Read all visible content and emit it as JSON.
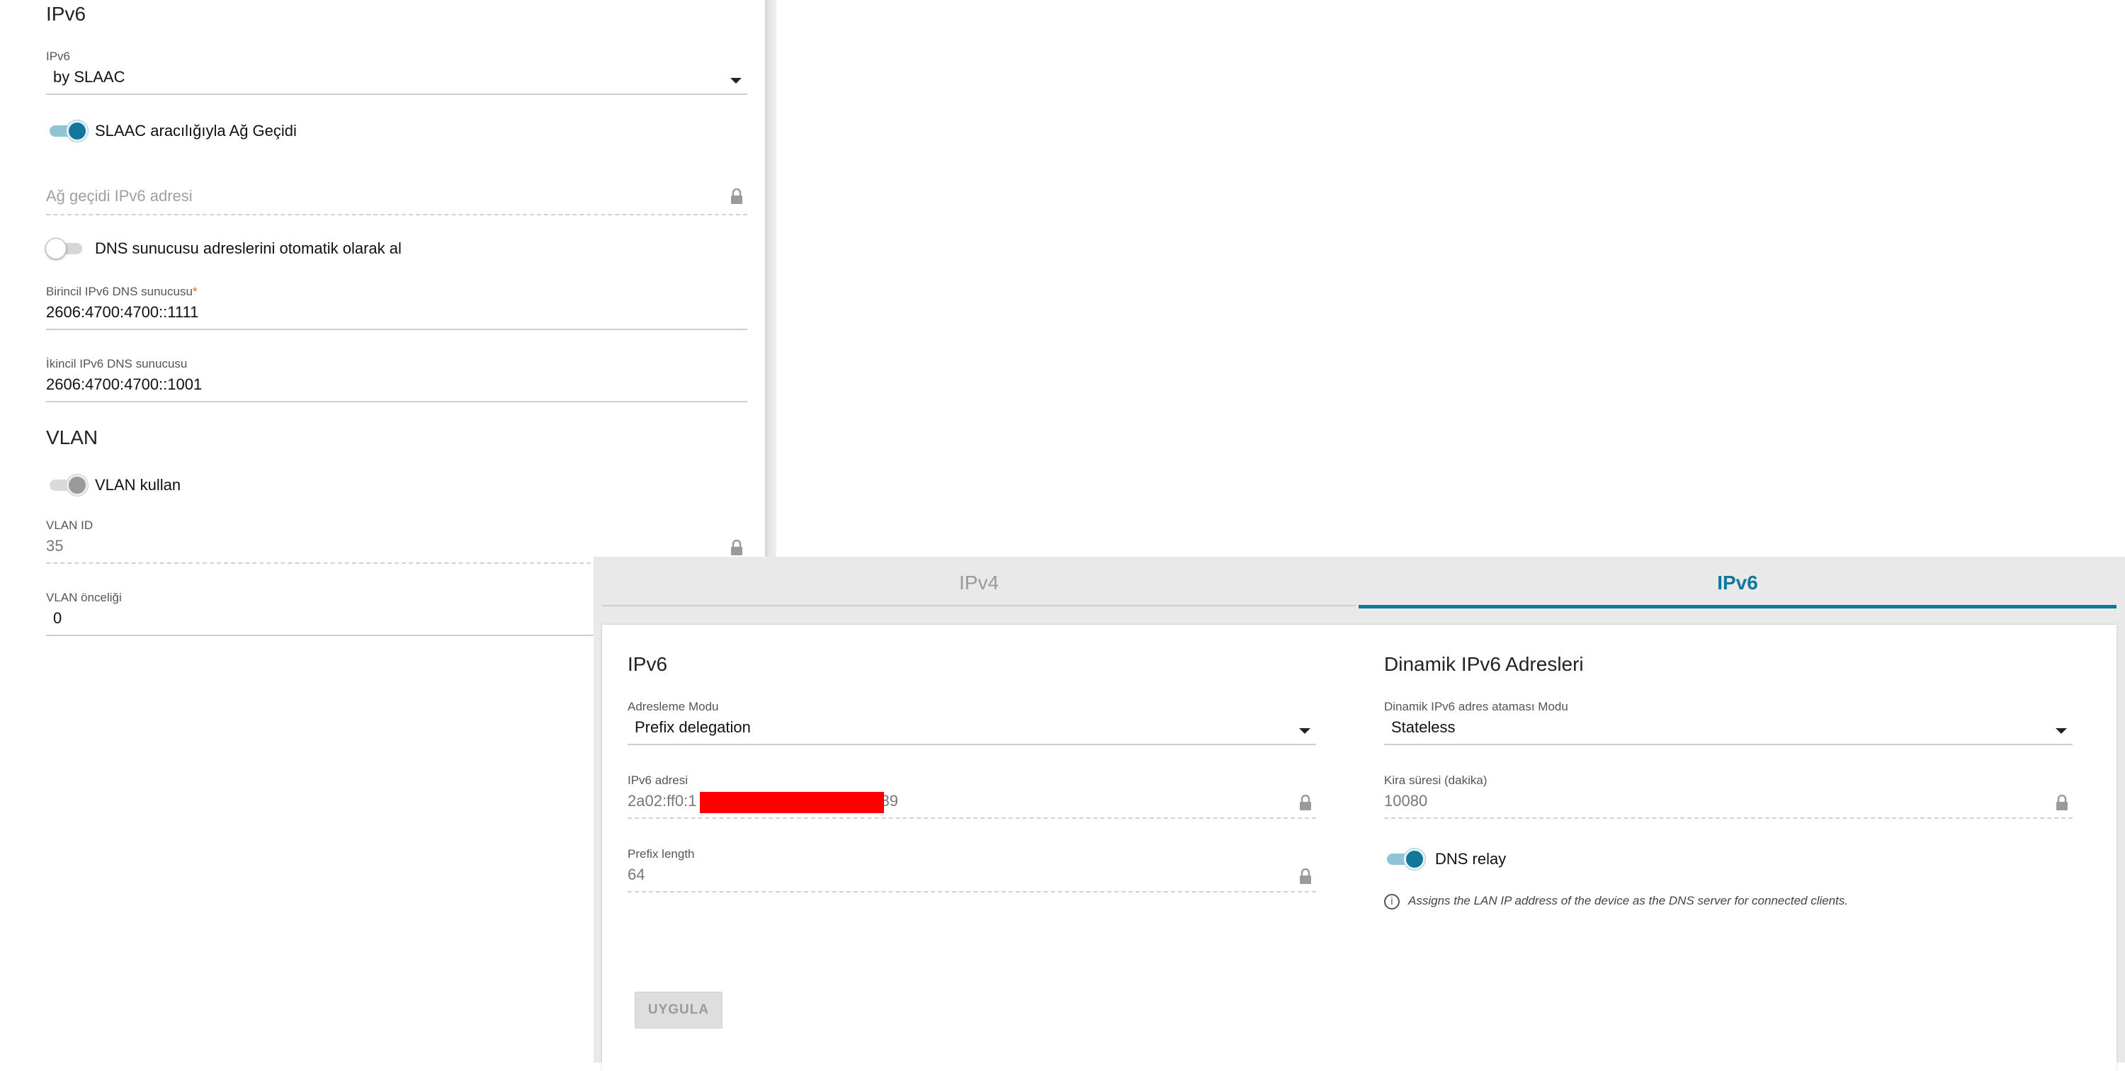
{
  "wan": {
    "ipv6_section_title": "IPv6",
    "ipv6_mode": {
      "label": "IPv6",
      "value": "by SLAAC"
    },
    "slaac_gateway_toggle": {
      "label": "SLAAC aracılığıyla Ağ Geçidi",
      "state": "on"
    },
    "gateway_address": {
      "placeholder": "Ağ geçidi IPv6 adresi"
    },
    "auto_dns_toggle": {
      "label": "DNS sunucusu adreslerini otomatik olarak al",
      "state": "off"
    },
    "primary_dns": {
      "label": "Birincil IPv6 DNS sunucusu",
      "required_mark": "*",
      "value": "2606:4700:4700::1111"
    },
    "secondary_dns": {
      "label": "İkincil IPv6 DNS sunucusu",
      "value": "2606:4700:4700::1001"
    },
    "vlan_section_title": "VLAN",
    "vlan_toggle": {
      "label": "VLAN kullan",
      "state": "on-disabled"
    },
    "vlan_id": {
      "label": "VLAN ID",
      "value": "35"
    },
    "vlan_priority": {
      "label": "VLAN önceliği",
      "value": "0"
    }
  },
  "lan": {
    "tabs": [
      {
        "label": "IPv4",
        "active": false
      },
      {
        "label": "IPv6",
        "active": true
      }
    ],
    "ipv6_section_title": "IPv6",
    "addressing_mode": {
      "label": "Adresleme Modu",
      "value": "Prefix delegation"
    },
    "ipv6_address": {
      "label": "IPv6 adresi",
      "value_prefix": "2a02:ff0:1",
      "value_suffix": "89"
    },
    "prefix_length": {
      "label": "Prefix length",
      "value": "64"
    },
    "dynamic_section_title": "Dinamik IPv6 Adresleri",
    "dynamic_mode": {
      "label": "Dinamik IPv6 adres ataması Modu",
      "value": "Stateless"
    },
    "lease_time": {
      "label": "Kira süresi (dakika)",
      "value": "10080"
    },
    "dns_relay_toggle": {
      "label": "DNS relay",
      "state": "on"
    },
    "dns_relay_hint": "Assigns the LAN IP address of the device as the DNS server for connected clients.",
    "apply_label": "UYGULA"
  },
  "colors": {
    "accent": "#12779a",
    "redaction": "#ff0000",
    "required": "#e06c1c"
  },
  "icons": [
    "caret-down-icon",
    "lock-icon",
    "info-icon"
  ]
}
